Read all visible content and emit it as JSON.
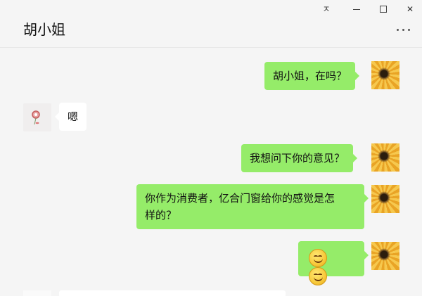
{
  "window": {
    "contact_name": "胡小姐",
    "pin_glyph": "ㅈ",
    "close_glyph": "✕"
  },
  "icons": {
    "pin": "pin-icon",
    "minimize": "minimize-icon",
    "maximize": "maximize-icon",
    "close": "close-icon",
    "more": "more-icon",
    "emoji": "smile-emoji-icon"
  },
  "colors": {
    "outgoing_bubble": "#95ec69",
    "incoming_bubble": "#ffffff",
    "background": "#f5f5f5"
  },
  "messages": [
    {
      "from": "me",
      "text": "胡小姐，在吗？"
    },
    {
      "from": "other",
      "text": "嗯"
    },
    {
      "from": "me",
      "text": "我想问下你的意见？"
    },
    {
      "from": "me",
      "text_line1": "你作为消费者，亿合门窗给你的感觉是怎",
      "text_line2": "样的？"
    },
    {
      "from": "me",
      "emoji": [
        "smile",
        "smile"
      ]
    }
  ]
}
